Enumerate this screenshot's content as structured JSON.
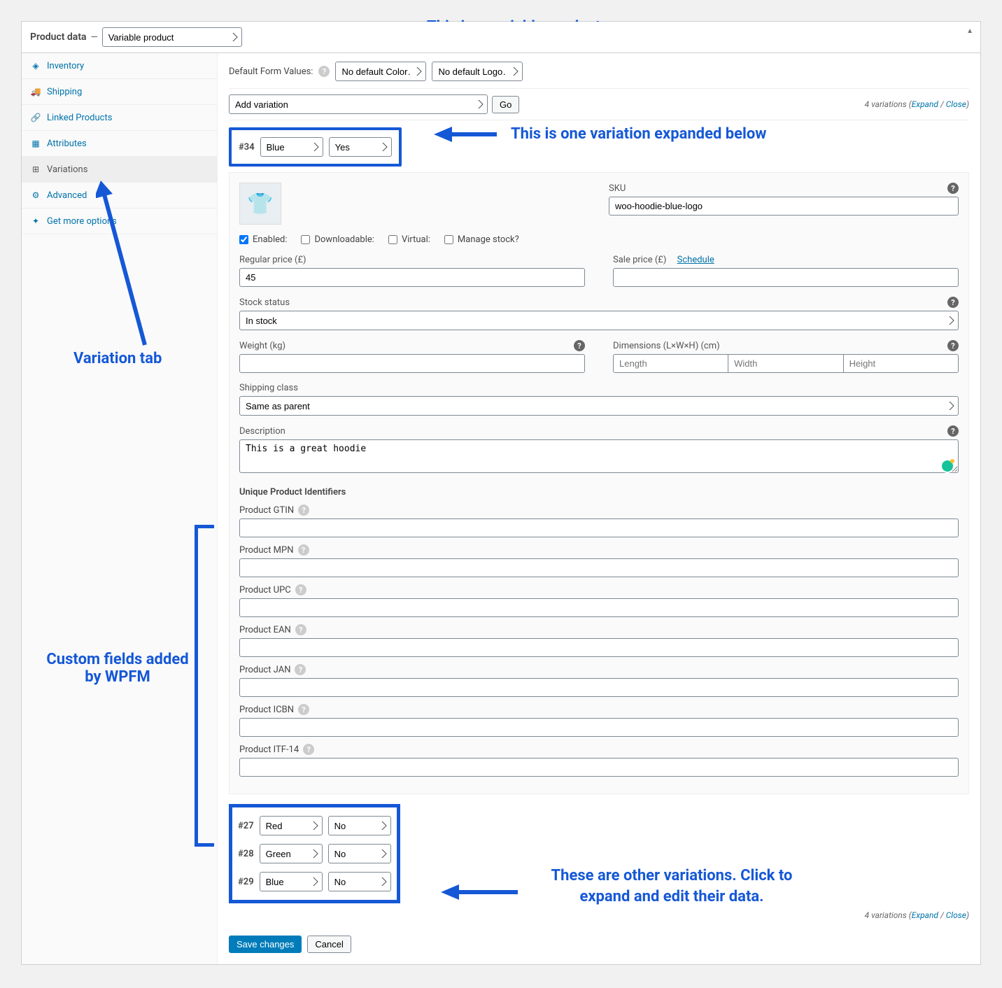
{
  "panel": {
    "title": "Product data",
    "product_type": "Variable product"
  },
  "sidebar": {
    "items": [
      {
        "label": "Inventory"
      },
      {
        "label": "Shipping"
      },
      {
        "label": "Linked Products"
      },
      {
        "label": "Attributes"
      },
      {
        "label": "Variations"
      },
      {
        "label": "Advanced"
      },
      {
        "label": "Get more options"
      }
    ]
  },
  "default_values": {
    "label": "Default Form Values:",
    "color": "No default Color…",
    "logo": "No default Logo…"
  },
  "toolbar": {
    "add_variation": "Add variation",
    "go": "Go",
    "count_text": "4 variations",
    "expand": "Expand",
    "close": "Close"
  },
  "variation": {
    "id": "#34",
    "attr_color": "Blue",
    "attr_logo": "Yes",
    "sku_label": "SKU",
    "sku": "woo-hoodie-blue-logo",
    "checks": {
      "enabled": "Enabled:",
      "downloadable": "Downloadable:",
      "virtual": "Virtual:",
      "manage_stock": "Manage stock?"
    },
    "regular_price_label": "Regular price (£)",
    "regular_price": "45",
    "sale_price_label": "Sale price (£)",
    "schedule": "Schedule",
    "stock_status_label": "Stock status",
    "stock_status": "In stock",
    "weight_label": "Weight (kg)",
    "dimensions_label": "Dimensions (L×W×H) (cm)",
    "dim_length_ph": "Length",
    "dim_width_ph": "Width",
    "dim_height_ph": "Height",
    "shipping_class_label": "Shipping class",
    "shipping_class": "Same as parent",
    "description_label": "Description",
    "description": "This is a great hoodie",
    "identifiers_title": "Unique Product Identifiers",
    "identifiers": [
      {
        "label": "Product GTIN"
      },
      {
        "label": "Product MPN"
      },
      {
        "label": "Product UPC"
      },
      {
        "label": "Product EAN"
      },
      {
        "label": "Product JAN"
      },
      {
        "label": "Product ICBN"
      },
      {
        "label": "Product ITF-14"
      }
    ]
  },
  "other_variations": [
    {
      "id": "#27",
      "color": "Red",
      "logo": "No"
    },
    {
      "id": "#28",
      "color": "Green",
      "logo": "No"
    },
    {
      "id": "#29",
      "color": "Blue",
      "logo": "No"
    }
  ],
  "footer": {
    "save": "Save changes",
    "cancel": "Cancel"
  },
  "annotations": {
    "a1": "This is a variable product",
    "a2": "This is one variation expanded below",
    "a3": "Variation tab",
    "a4": "Custom fields added by WPFM",
    "a5": "These are other variations. Click to expand and edit their data."
  }
}
